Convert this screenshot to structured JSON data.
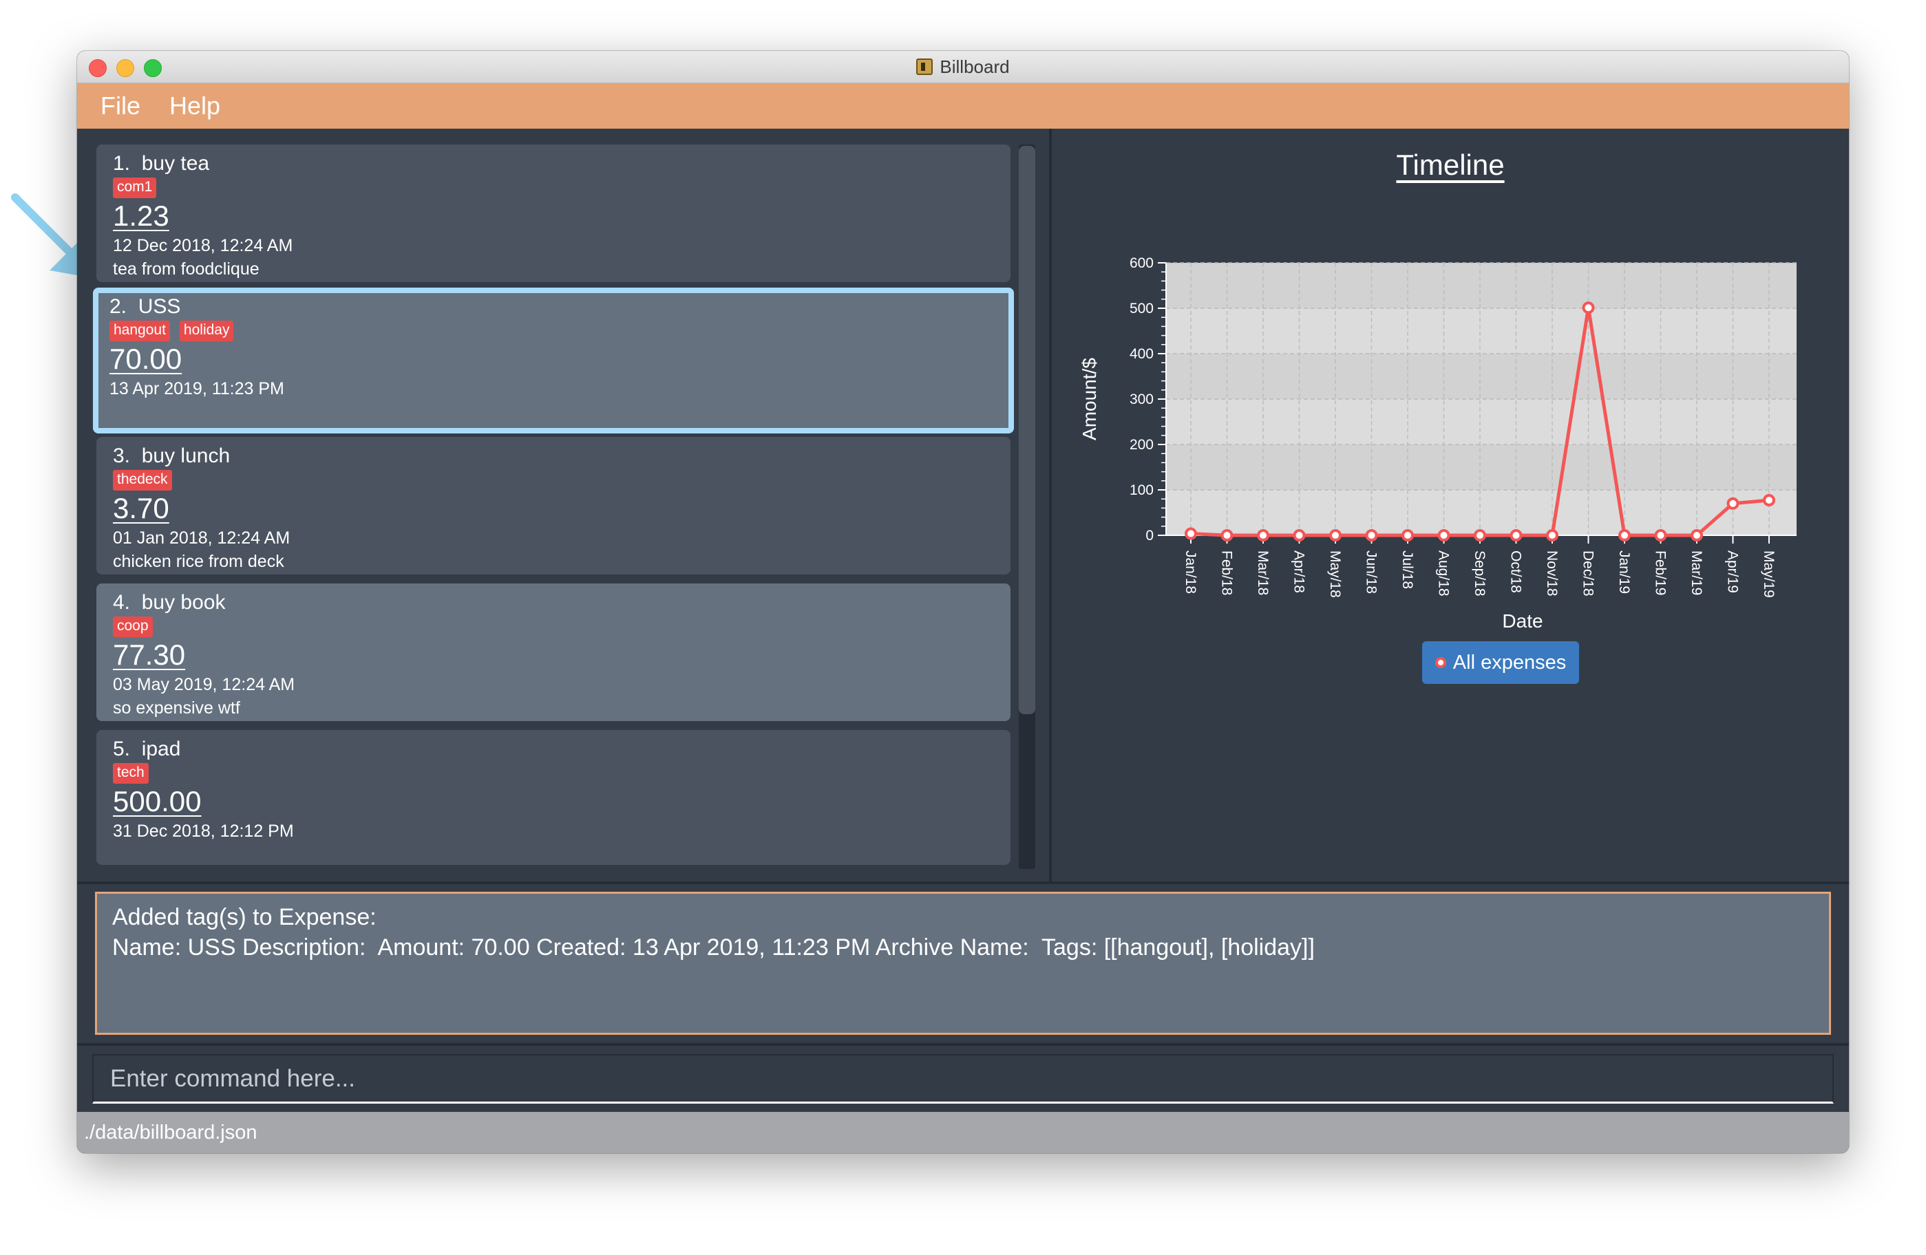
{
  "window": {
    "title": "Billboard"
  },
  "menu": {
    "file": "File",
    "help": "Help"
  },
  "expenses": [
    {
      "index": "1.",
      "name": "buy tea",
      "tags": [
        "com1"
      ],
      "amount": "1.23",
      "date": "12 Dec 2018, 12:24 AM",
      "description": "tea from foodclique"
    },
    {
      "index": "2.",
      "name": "USS",
      "tags": [
        "hangout",
        "holiday"
      ],
      "amount": "70.00",
      "date": "13 Apr 2019, 11:23 PM",
      "description": ""
    },
    {
      "index": "3.",
      "name": "buy lunch",
      "tags": [
        "thedeck"
      ],
      "amount": "3.70",
      "date": "01 Jan 2018, 12:24 AM",
      "description": "chicken rice from deck"
    },
    {
      "index": "4.",
      "name": "buy book",
      "tags": [
        "coop"
      ],
      "amount": "77.30",
      "date": "03 May 2019, 12:24 AM",
      "description": "so expensive wtf"
    },
    {
      "index": "5.",
      "name": "ipad",
      "tags": [
        "tech"
      ],
      "amount": "500.00",
      "date": "31 Dec 2018, 12:12 PM",
      "description": ""
    }
  ],
  "timeline": {
    "title": "Timeline",
    "legend": "All expenses"
  },
  "chart_data": {
    "type": "line",
    "title": "Timeline",
    "xlabel": "Date",
    "ylabel": "Amount/$",
    "ylim": [
      0,
      600
    ],
    "yticks": [
      0,
      100,
      200,
      300,
      400,
      500,
      600
    ],
    "grid": true,
    "categories": [
      "Jan/18",
      "Feb/18",
      "Mar/18",
      "Apr/18",
      "May/18",
      "Jun/18",
      "Jul/18",
      "Aug/18",
      "Sep/18",
      "Oct/18",
      "Nov/18",
      "Dec/18",
      "Jan/19",
      "Feb/19",
      "Mar/19",
      "Apr/19",
      "May/19"
    ],
    "series": [
      {
        "name": "All expenses",
        "values": [
          3.7,
          0,
          0,
          0,
          0,
          0,
          0,
          0,
          0,
          0,
          0,
          501.23,
          0,
          0,
          0,
          70,
          77.3
        ]
      }
    ],
    "colors": {
      "line": "#f55656",
      "plot_bg": "#dcdcdc",
      "band": "#d2d2d2",
      "axis_text": "#ffffff"
    }
  },
  "result": {
    "line1": "Added tag(s) to Expense:",
    "line2": "Name: USS Description:  Amount: 70.00 Created: 13 Apr 2019, 11:23 PM Archive Name:  Tags: [[hangout], [holiday]]"
  },
  "command": {
    "placeholder": "Enter command here..."
  },
  "status": {
    "path": "./data/billboard.json"
  },
  "colors": {
    "menu_accent": "#e6a476",
    "selected_border": "#a9dcfa",
    "tag": "#e74c4c"
  }
}
